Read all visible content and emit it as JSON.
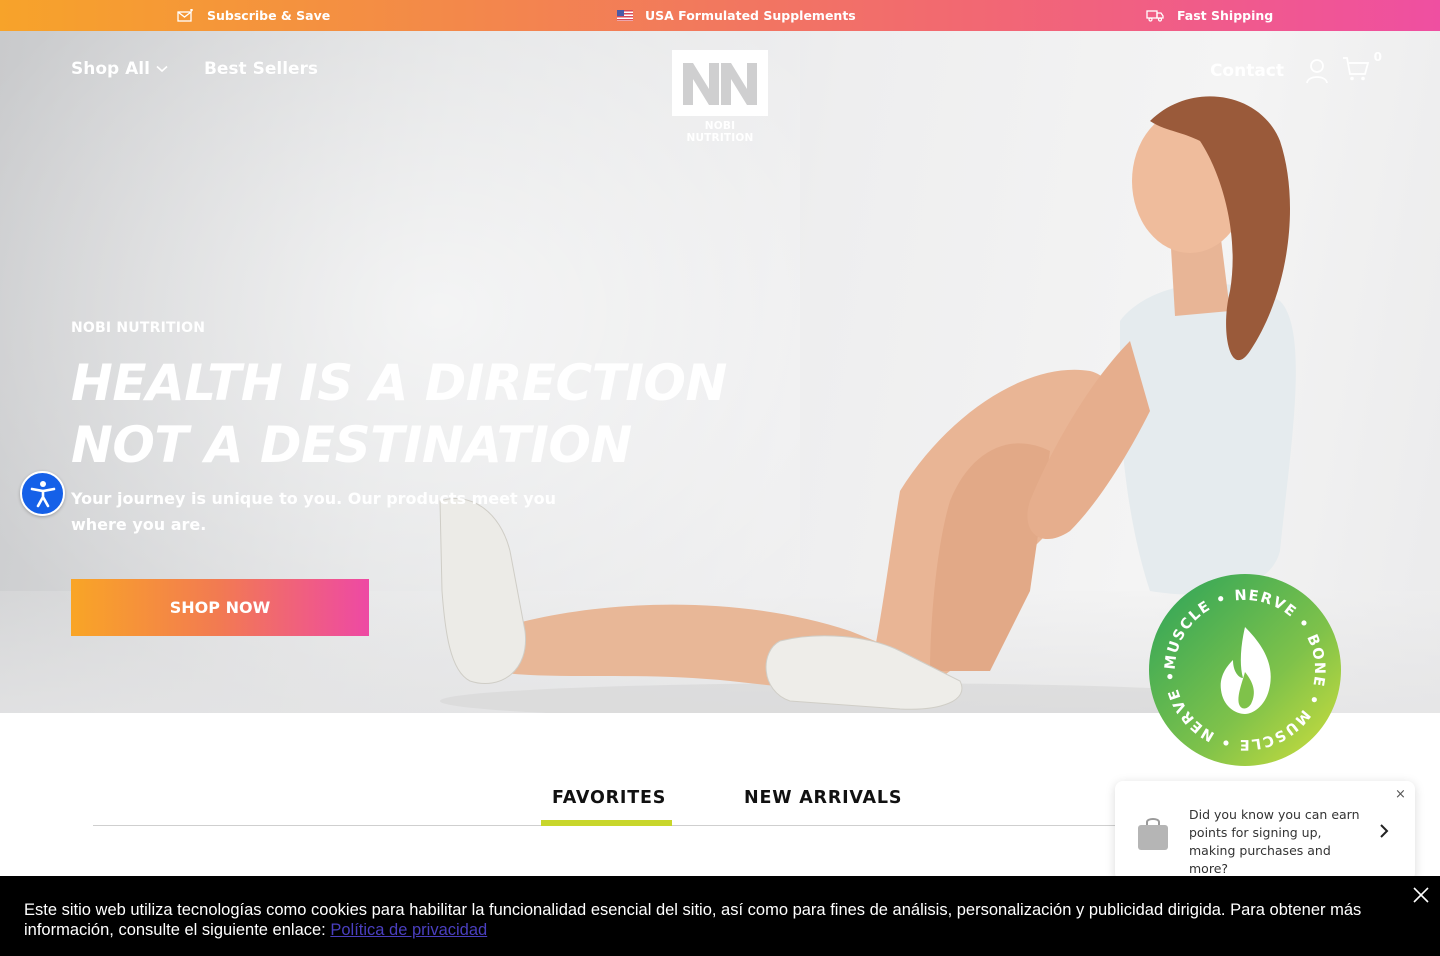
{
  "announcement": {
    "items": [
      {
        "label": "Subscribe & Save",
        "icon": "subscribe-icon"
      },
      {
        "label": "USA Formulated Supplements",
        "icon": "us-flag-icon"
      },
      {
        "label": "Fast Shipping",
        "icon": "truck-icon"
      }
    ]
  },
  "header": {
    "nav_left": [
      {
        "label": "Shop All",
        "icon": "chevron-down-icon"
      },
      {
        "label": "Best Sellers"
      }
    ],
    "logo": {
      "brand": "NOBI NUTRITION"
    },
    "contact_label": "Contact",
    "cart_count": "0"
  },
  "hero": {
    "eyebrow": "NOBI NUTRITION",
    "headline_line1": "HEALTH IS A DIRECTION",
    "headline_line2": "NOT A DESTINATION",
    "subline": "Your journey is unique to you. Our products meet you where you are.",
    "cta_label": "SHOP NOW"
  },
  "badge": {
    "words": [
      "MUSCLE",
      "NERVE",
      "BONE",
      "MUSCLE",
      "NERVE",
      "BONE"
    ]
  },
  "tabs": {
    "items": [
      {
        "label": "FAVORITES",
        "active": true
      },
      {
        "label": "NEW ARRIVALS",
        "active": false
      }
    ],
    "active_color": "#c8d62b"
  },
  "loyalty_popup": {
    "message": "Did you know you can earn points for signing up, making purchases and more?"
  },
  "cookie_banner": {
    "text": "Este sitio web utiliza tecnologías como cookies para habilitar la funcionalidad esencial del sitio, así como para fines de análisis, personalización y publicidad dirigida. Para obtener más información, consulte el siguiente enlace: ",
    "link_label": "Política de privacidad"
  },
  "colors": {
    "gradient_start": "#f7a32a",
    "gradient_end": "#ef4fa1",
    "accessibility_blue": "#1560e8",
    "badge_green": "#4caf50"
  }
}
